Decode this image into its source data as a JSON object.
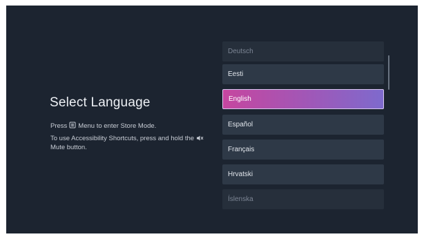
{
  "title": "Select Language",
  "store_mode": {
    "pre": "Press",
    "post": "Menu to enter Store Mode."
  },
  "accessibility": {
    "pre": "To use Accessibility Shortcuts, press and hold the",
    "post": "Mute button."
  },
  "languages": [
    {
      "label": "Deutsch",
      "state": "faded"
    },
    {
      "label": "Eesti",
      "state": "normal"
    },
    {
      "label": "English",
      "state": "selected"
    },
    {
      "label": "Español",
      "state": "normal"
    },
    {
      "label": "Français",
      "state": "normal"
    },
    {
      "label": "Hrvatski",
      "state": "normal"
    },
    {
      "label": "Íslenska",
      "state": "faded"
    }
  ],
  "colors": {
    "background": "#1c2430",
    "item": "#2e3947",
    "selected_start": "#c6469f",
    "selected_end": "#7e6acd"
  },
  "icons": [
    "menu-icon",
    "mute-icon"
  ]
}
